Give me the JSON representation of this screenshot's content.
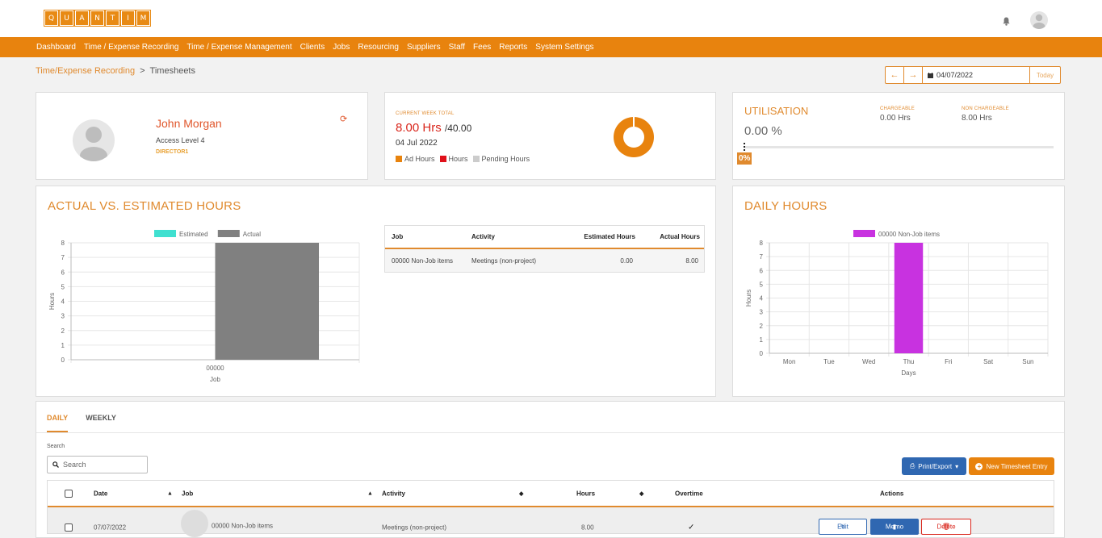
{
  "brand": {
    "letters": [
      "Q",
      "U",
      "A",
      "N",
      "T",
      "I",
      "M"
    ]
  },
  "nav": [
    "Dashboard",
    "Time / Expense Recording",
    "Time / Expense Management",
    "Clients",
    "Jobs",
    "Resourcing",
    "Suppliers",
    "Staff",
    "Fees",
    "Reports",
    "System Settings"
  ],
  "breadcrumb": {
    "parent": "Time/Expense Recording",
    "separator": ">",
    "current": "Timesheets"
  },
  "date_nav": {
    "prev_icon": "arrow-left-icon",
    "next_icon": "arrow-right-icon",
    "date": "04/07/2022",
    "today": "Today"
  },
  "profile": {
    "name": "John Morgan",
    "access": "Access Level 4",
    "role": "DIRECTOR1"
  },
  "current_week": {
    "label": "CURRENT WEEK TOTAL",
    "hours": "8.00 Hrs",
    "of": "/40.00",
    "date": "04 Jul 2022",
    "legend": [
      {
        "label": "Ad Hours",
        "color": "#e8830e"
      },
      {
        "label": "Hours",
        "color": "#e0101a"
      },
      {
        "label": "Pending Hours",
        "color": "#cccccc"
      }
    ]
  },
  "utilisation": {
    "title": "UTILISATION",
    "value": "0.00 %",
    "chargeable_label": "CHARGEABLE",
    "chargeable": "0.00 Hrs",
    "non_chargeable_label": "NON CHARGEABLE",
    "non_chargeable": "8.00 Hrs",
    "badge": "0%",
    "progress": 0
  },
  "actual_vs_est": {
    "title": "ACTUAL VS. ESTIMATED HOURS",
    "table": {
      "headers": [
        "Job",
        "Activity",
        "Estimated Hours",
        "Actual Hours"
      ],
      "rows": [
        [
          "00000 Non-Job items",
          "Meetings (non-project)",
          "0.00",
          "8.00"
        ]
      ]
    }
  },
  "daily_hours": {
    "title": "DAILY HOURS"
  },
  "chart_data": [
    {
      "type": "bar",
      "categories": [
        "00000"
      ],
      "series": [
        {
          "name": "Estimated",
          "values": [
            0
          ],
          "color": "#40e0d0"
        },
        {
          "name": "Actual",
          "values": [
            8
          ],
          "color": "#808080"
        }
      ],
      "xlabel": "Job",
      "ylabel": "Hours",
      "ylim": [
        0,
        8
      ],
      "yticks": [
        0,
        1,
        2,
        3,
        4,
        5,
        6,
        7,
        8
      ],
      "legend": "top"
    },
    {
      "type": "bar",
      "categories": [
        "Mon",
        "Tue",
        "Wed",
        "Thu",
        "Fri",
        "Sat",
        "Sun"
      ],
      "series": [
        {
          "name": "00000 Non-Job items",
          "values": [
            0,
            0,
            0,
            8,
            0,
            0,
            0
          ],
          "color": "#c832e0"
        }
      ],
      "xlabel": "Days",
      "ylabel": "Hours",
      "ylim": [
        0,
        8
      ],
      "yticks": [
        0,
        1,
        2,
        3,
        4,
        5,
        6,
        7,
        8
      ],
      "legend": "top"
    }
  ],
  "tabs": [
    "DAILY",
    "WEEKLY"
  ],
  "search": {
    "label": "Search",
    "placeholder": "Search"
  },
  "buttons": {
    "print": "Print/Export",
    "new_entry": "New Timesheet Entry"
  },
  "grid": {
    "headers": {
      "date": "Date",
      "job": "Job",
      "activity": "Activity",
      "hours": "Hours",
      "overtime": "Overtime",
      "actions": "Actions"
    },
    "rows": [
      {
        "date": "07/07/2022",
        "job": "00000 Non-Job items",
        "activity": "Meetings (non-project)",
        "hours": "8.00",
        "overtime": "✓"
      }
    ],
    "actions": {
      "edit": "Edit",
      "memo": "Memo",
      "delete": "Delete"
    }
  }
}
